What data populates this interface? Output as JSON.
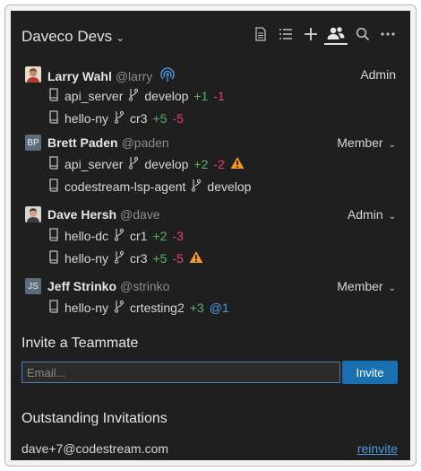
{
  "header": {
    "team_name": "Daveco Devs",
    "icons": [
      "document-icon",
      "list-icon",
      "plus-icon",
      "team-icon",
      "search-icon",
      "more-icon"
    ]
  },
  "members": [
    {
      "name": "Larry Wahl",
      "handle": "@larry",
      "role": "Admin",
      "role_dropdown": false,
      "avatar": "photo",
      "live": true,
      "repos": [
        {
          "repo": "api_server",
          "branch": "develop",
          "added": "+1",
          "removed": "-1",
          "warning": false,
          "mention": ""
        },
        {
          "repo": "hello-ny",
          "branch": "cr3",
          "added": "+5",
          "removed": "-5",
          "warning": false,
          "mention": ""
        }
      ]
    },
    {
      "name": "Brett Paden",
      "handle": "@paden",
      "role": "Member",
      "role_dropdown": true,
      "avatar": "initials",
      "initials": "BP",
      "repos": [
        {
          "repo": "api_server",
          "branch": "develop",
          "added": "+2",
          "removed": "-2",
          "warning": true,
          "mention": ""
        },
        {
          "repo": "codestream-lsp-agent",
          "branch": "develop",
          "added": "",
          "removed": "",
          "warning": false,
          "mention": ""
        }
      ]
    },
    {
      "name": "Dave Hersh",
      "handle": "@dave",
      "role": "Admin",
      "role_dropdown": true,
      "avatar": "photo",
      "repos": [
        {
          "repo": "hello-dc",
          "branch": "cr1",
          "added": "+2",
          "removed": "-3",
          "warning": false,
          "mention": ""
        },
        {
          "repo": "hello-ny",
          "branch": "cr3",
          "added": "+5",
          "removed": "-5",
          "warning": true,
          "mention": ""
        }
      ]
    },
    {
      "name": "Jeff Strinko",
      "handle": "@strinko",
      "role": "Member",
      "role_dropdown": true,
      "avatar": "initials",
      "initials": "JS",
      "repos": [
        {
          "repo": "hello-ny",
          "branch": "crtesting2",
          "added": "+3",
          "removed": "",
          "warning": false,
          "mention": "@1"
        }
      ]
    }
  ],
  "invite": {
    "title": "Invite a Teammate",
    "placeholder": "Email...",
    "button_label": "Invite"
  },
  "outstanding": {
    "title": "Outstanding Invitations",
    "items": [
      {
        "email": "dave+7@codestream.com",
        "action": "reinvite"
      }
    ]
  },
  "colors": {
    "background": "#1f1f1f",
    "added": "#51b36a",
    "removed": "#e0446a",
    "link": "#4a9ae0",
    "button": "#1a6fae",
    "warning": "#f0962e"
  }
}
